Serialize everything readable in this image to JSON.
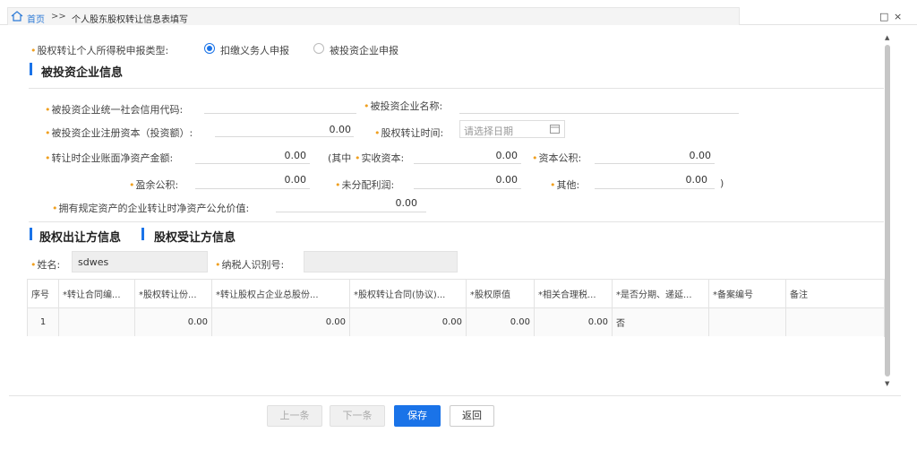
{
  "breadcrumb": {
    "home": "首页",
    "sep": ">>",
    "title": "个人股东股权转让信息表填写"
  },
  "window": {
    "restore": "□",
    "close": "×"
  },
  "declaration": {
    "label": "股权转让个人所得税申报类型:",
    "option1": "扣缴义务人申报",
    "option2": "被投资企业申报",
    "selected": "扣缴义务人申报"
  },
  "invested_section": {
    "title": "被投资企业信息",
    "credit_code_label": "被投资企业统一社会信用代码:",
    "name_label": "被投资企业名称:",
    "capital_label": "被投资企业注册资本（投资额）:",
    "capital_value": "0.00",
    "transfer_time_label": "股权转让时间:",
    "transfer_time_placeholder": "请选择日期",
    "net_assets_label": "转让时企业账面净资产金额:",
    "net_assets_value": "0.00",
    "paren_open": "(其中",
    "paid_in_label": "实收资本:",
    "paid_in_value": "0.00",
    "capital_reserve_label": "资本公积:",
    "capital_reserve_value": "0.00",
    "surplus_label": "盈余公积:",
    "surplus_value": "0.00",
    "undistributed_label": "未分配利润:",
    "undistributed_value": "0.00",
    "other_label": "其他:",
    "other_value": "0.00",
    "paren_close": ")",
    "fair_value_label": "拥有规定资产的企业转让时净资产公允价值:",
    "fair_value_value": "0.00"
  },
  "transfer_section": {
    "title_out": "股权出让方信息",
    "title_in": "股权受让方信息",
    "name_label": "姓名:",
    "name_value": "sdwes",
    "taxpayer_id_label": "纳税人识别号:",
    "taxpayer_id_value": ""
  },
  "table": {
    "headers": [
      "序号",
      "*转让合同编...",
      "*股权转让份...",
      "*转让股权占企业总股份...",
      "*股权转让合同(协议)...",
      "*股权原值",
      "*相关合理税...",
      "*是否分期、递延...",
      "*备案编号",
      "备注"
    ],
    "rows": [
      [
        "1",
        "",
        "0.00",
        "0.00",
        "0.00",
        "0.00",
        "0.00",
        "否",
        "",
        ""
      ]
    ]
  },
  "footer": {
    "prev": "上一条",
    "next": "下一条",
    "save": "保存",
    "back": "返回"
  },
  "colors": {
    "accent": "#1a73e8",
    "required": "#f0a020"
  }
}
